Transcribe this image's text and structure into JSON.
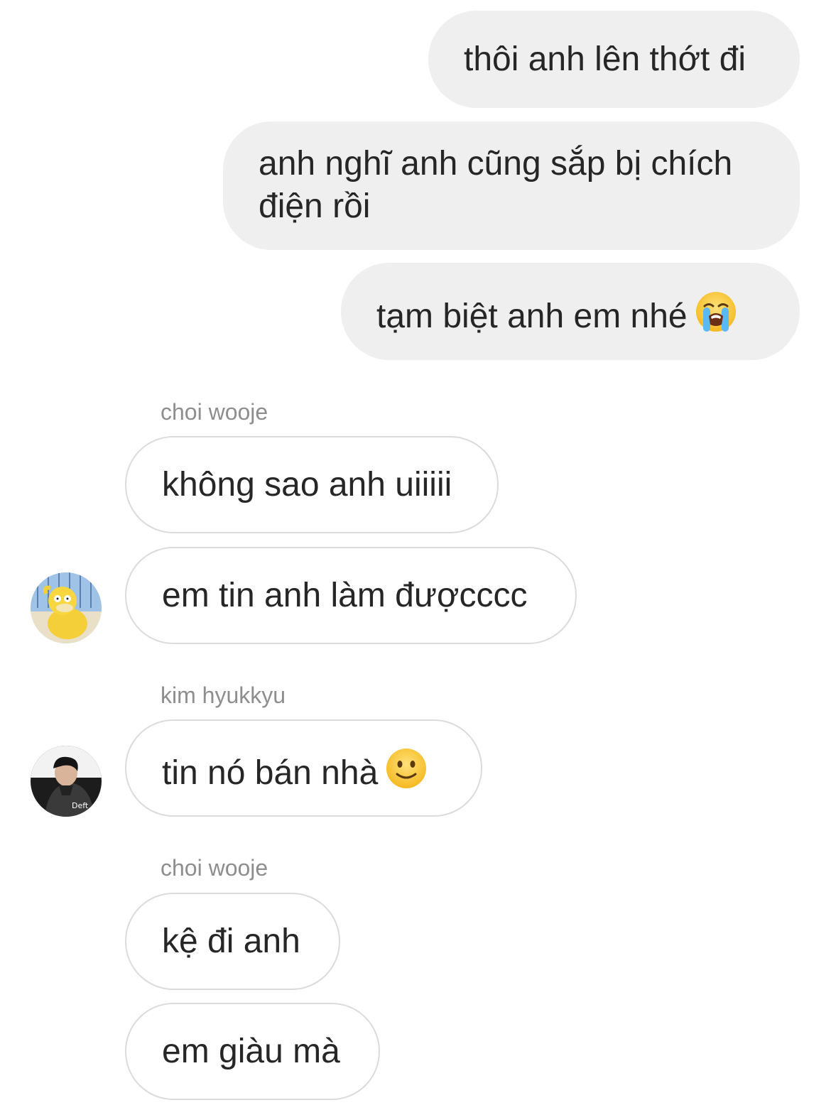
{
  "messages": [
    {
      "text": "thôi anh lên thớt đi"
    },
    {
      "text": "anh nghĩ anh cũng sắp bị chích điện rồi"
    },
    {
      "text": "tạm biệt anh em nhé",
      "emoji": "loudly-crying-face-icon"
    },
    {
      "sender": "choi wooje",
      "text": "không sao anh uiiiii"
    },
    {
      "text": "em tin anh làm đượcccc",
      "avatar": "psyduck-avatar"
    },
    {
      "sender": "kim hyukkyu",
      "text": "tin nó bán nhà",
      "emoji": "slightly-smiling-face-icon",
      "avatar": "deft-avatar",
      "avatar_text": "Deft"
    },
    {
      "sender": "choi wooje",
      "text": "kệ đi anh"
    },
    {
      "text": "em giàu mà"
    }
  ],
  "colors": {
    "outgoing_bubble": "#efefef",
    "incoming_border": "#dbdbdb",
    "sender_name": "#8e8e8e",
    "text": "#262626"
  }
}
